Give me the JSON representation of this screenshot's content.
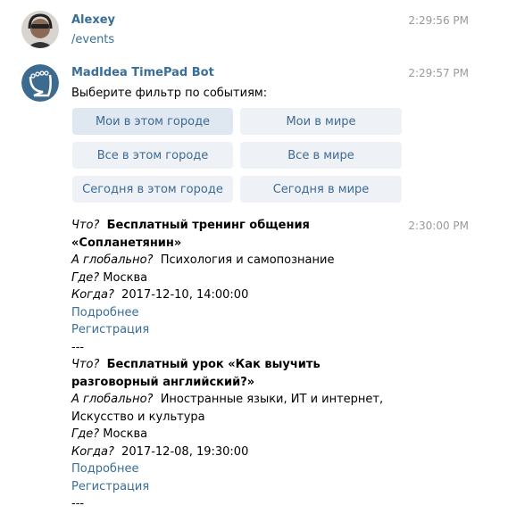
{
  "messages": [
    {
      "sender": "Alexey",
      "time": "2:29:56 PM",
      "text": "/events"
    },
    {
      "sender": "MadIdea TimePad Bot",
      "time": "2:29:57 PM",
      "text": "Выберите фильтр по событиям:",
      "keyboard": [
        "Мои в этом городе",
        "Мои в мире",
        "Все в этом городе",
        "Все в мире",
        "Сегодня в этом городе",
        "Сегодня в мире"
      ]
    },
    {
      "time": "2:30:00 PM",
      "events": [
        {
          "what_label": "Что?",
          "title1": "Бесплатный тренинг общения",
          "title2": "«Сопланетянин»",
          "global_label": "А глобально?",
          "global1": "Психология и самопознание",
          "global2": "",
          "where_label": "Где?",
          "where": "Москва",
          "when_label": "Когда?",
          "when": "2017-12-10, 14:00:00",
          "more": "Подробнее",
          "register": "Регистрация",
          "sep": "---"
        },
        {
          "what_label": "Что?",
          "title1": "Бесплатный урок «Как выучить",
          "title2": "разговорный английский?»",
          "global_label": "А глобально?",
          "global1": "Иностранные языки, ИТ и интернет,",
          "global2": "Искусство и культура",
          "where_label": "Где?",
          "where": "Москва",
          "when_label": "Когда?",
          "when": "2017-12-08, 19:30:00",
          "more": "Подробнее",
          "register": "Регистрация",
          "sep": "---"
        }
      ]
    }
  ],
  "colors": {
    "accent": "#3a6d99",
    "button_bg": "#eef2f6",
    "button_active_bg": "#dfe7f0"
  }
}
